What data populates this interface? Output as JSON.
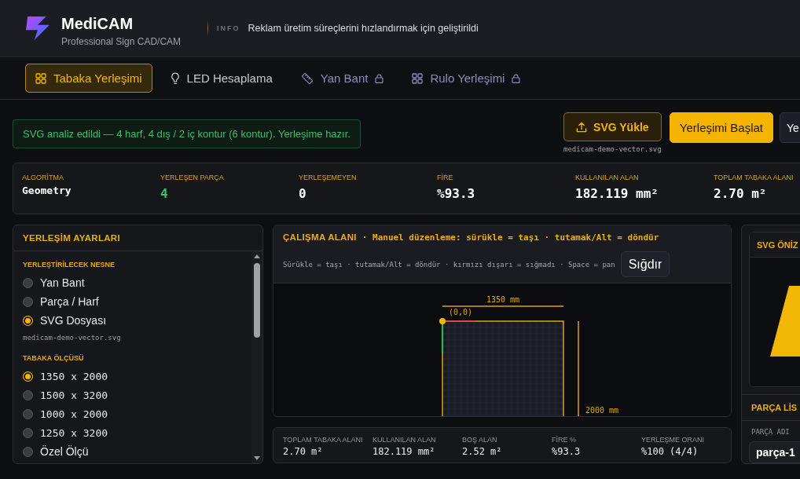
{
  "header": {
    "app_name": "MediCAM",
    "tagline": "Professional Sign CAD/CAM",
    "info_label": "INFO",
    "info_text": "Reklam üretim süreçlerini hızlandırmak için geliştirildi"
  },
  "tabs": [
    {
      "label": "Tabaka Yerleşimi",
      "selected": true,
      "locked": false
    },
    {
      "label": "LED Hesaplama",
      "selected": false,
      "locked": false
    },
    {
      "label": "Yan Bant",
      "selected": false,
      "locked": true
    },
    {
      "label": "Rulo Yerleşimi",
      "selected": false,
      "locked": true
    }
  ],
  "status_message": {
    "kind": "success",
    "text": "SVG analiz edildi — 4 harf, 4 dış / 2 iç kontur (6 kontur). Yerleşime hazır."
  },
  "actions": [
    {
      "kind": "upload",
      "label": "SVG Yükle",
      "file_name": "medicam-demo-vector.svg"
    },
    {
      "kind": "primary",
      "label": "Yerleşimi Başlat"
    },
    {
      "kind": "secondary",
      "label": "Ye"
    }
  ],
  "summary": [
    {
      "label": "ALGORİTMA",
      "value": "Geometry",
      "kind": "text",
      "color": "#ffffff"
    },
    {
      "label": "YERLEŞEN PARÇA",
      "value": "4",
      "kind": "metric",
      "color": "#3ebd6f"
    },
    {
      "label": "YERLEŞEMEYEN",
      "value": "0",
      "kind": "metric",
      "color": "#ffffff"
    },
    {
      "label": "FİRE",
      "value": "%93.3",
      "kind": "metric",
      "color": "#ffffff"
    },
    {
      "label": "KULLANILAN ALAN",
      "value": "182.119 mm²",
      "kind": "metric",
      "color": "#ffffff"
    },
    {
      "label": "TOPLAM TABAKA ALANI",
      "value": "2.70 m²",
      "kind": "metric",
      "color": "#ffffff"
    }
  ],
  "settings_panel": {
    "title": "YERLEŞİM AYARLARI",
    "sections": [
      {
        "title": "YERLEŞTİRİLECEK NESNE",
        "options": [
          {
            "label": "Yan Bant",
            "kind": "text",
            "selected": false
          },
          {
            "label": "Parça / Harf",
            "kind": "text",
            "selected": false
          },
          {
            "label": "SVG Dosyası",
            "kind": "text",
            "selected": true
          }
        ],
        "note": "medicam-demo-vector.svg"
      },
      {
        "title": "TABAKA ÖLÇÜSÜ",
        "options": [
          {
            "label": "1350 x 2000",
            "kind": "size",
            "selected": true
          },
          {
            "label": "1500 x 3200",
            "kind": "size",
            "selected": false
          },
          {
            "label": "1000 x 2000",
            "kind": "size",
            "selected": false
          },
          {
            "label": "1250 x 3200",
            "kind": "size",
            "selected": false
          },
          {
            "label": "Özel Ölçü",
            "kind": "text",
            "selected": false
          }
        ]
      }
    ]
  },
  "workspace": {
    "title": "ÇALIŞMA ALANI",
    "mode_hint": "· Manuel düzenleme: sürükle = taşı · tutamak/Alt = döndür",
    "help": "Sürükle = taşı · tutamak/Alt = döndür · kırmızı dışarı = sığmadı · Space = pan",
    "fit_button": "Sığdır",
    "canvas": {
      "width_label": "1350 mm",
      "origin_label": "(0,0)",
      "height_label": "2000 mm"
    },
    "stats": [
      {
        "label": "TOPLAM TABAKA ALANI",
        "value": "2.70 m²"
      },
      {
        "label": "KULLANILAN ALAN",
        "value": "182.119 mm²"
      },
      {
        "label": "BOŞ ALAN",
        "value": "2.52 m²"
      },
      {
        "label": "FİRE %",
        "value": "%93.3"
      },
      {
        "label": "YERLEŞME ORANI",
        "value": "%100 (4/4)"
      }
    ]
  },
  "preview_panel": {
    "title": "SVG ÖNİZ"
  },
  "parts_panel": {
    "title": "PARÇA LİS",
    "column": "PARÇA ADI",
    "rows": [
      {
        "name": "parça-1"
      }
    ]
  }
}
